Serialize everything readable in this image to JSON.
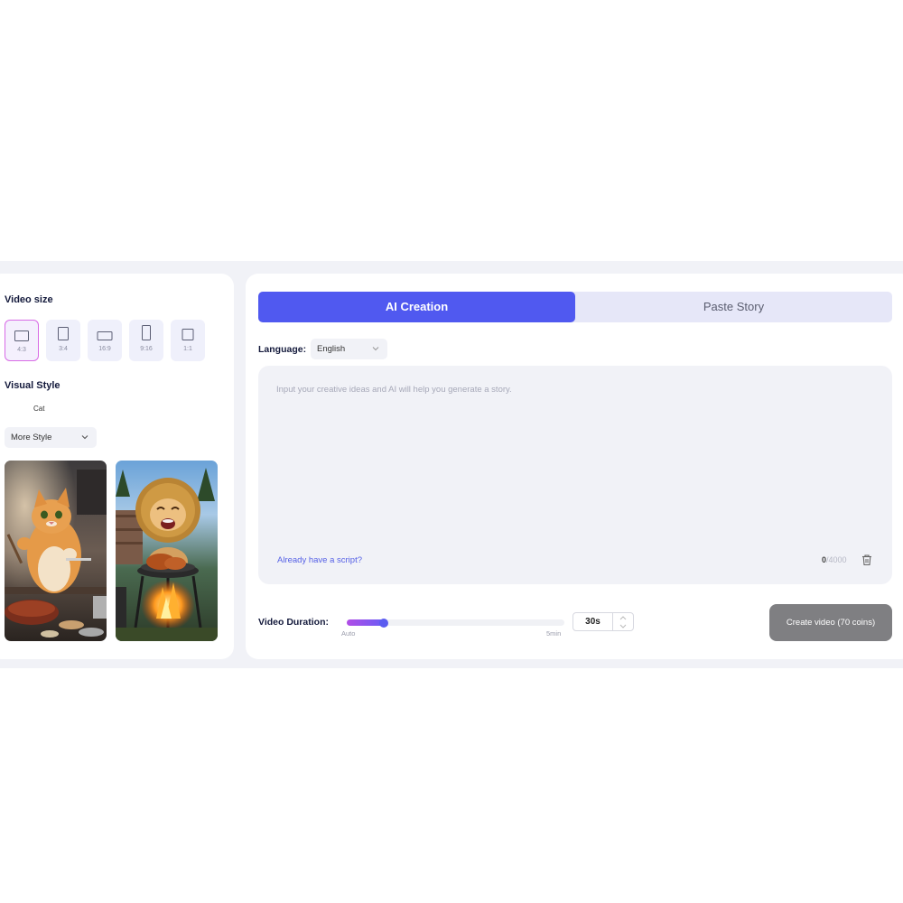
{
  "video_size": {
    "title": "Video size",
    "options": [
      {
        "label": "4:3",
        "selected": true
      },
      {
        "label": "3:4",
        "selected": false
      },
      {
        "label": "16:9",
        "selected": false
      },
      {
        "label": "9:16",
        "selected": false
      },
      {
        "label": "1:1",
        "selected": false
      }
    ]
  },
  "visual_style": {
    "title": "Visual Style",
    "current": "Cat",
    "more_label": "More Style",
    "thumbnails": [
      {
        "icon": "cat-chef-cooking-steak-image"
      },
      {
        "icon": "lion-cat-grilling-image"
      }
    ]
  },
  "tabs": [
    {
      "label": "AI Creation",
      "active": true
    },
    {
      "label": "Paste Story",
      "active": false
    }
  ],
  "language": {
    "label": "Language:",
    "value": "English"
  },
  "story": {
    "placeholder": "Input your creative ideas and AI will help you generate a story.",
    "script_link": "Already have a script?",
    "count": "0",
    "max": "/4000"
  },
  "duration": {
    "label": "Video Duration:",
    "min_label": "Auto",
    "max_label": "5min",
    "value": "30s",
    "slider_fraction": 0.17
  },
  "create_button": "Create video  (70 coins)",
  "colors": {
    "accent": "#5059f0",
    "selected_border": "#d86be6",
    "create_button": "#7f7f82"
  }
}
